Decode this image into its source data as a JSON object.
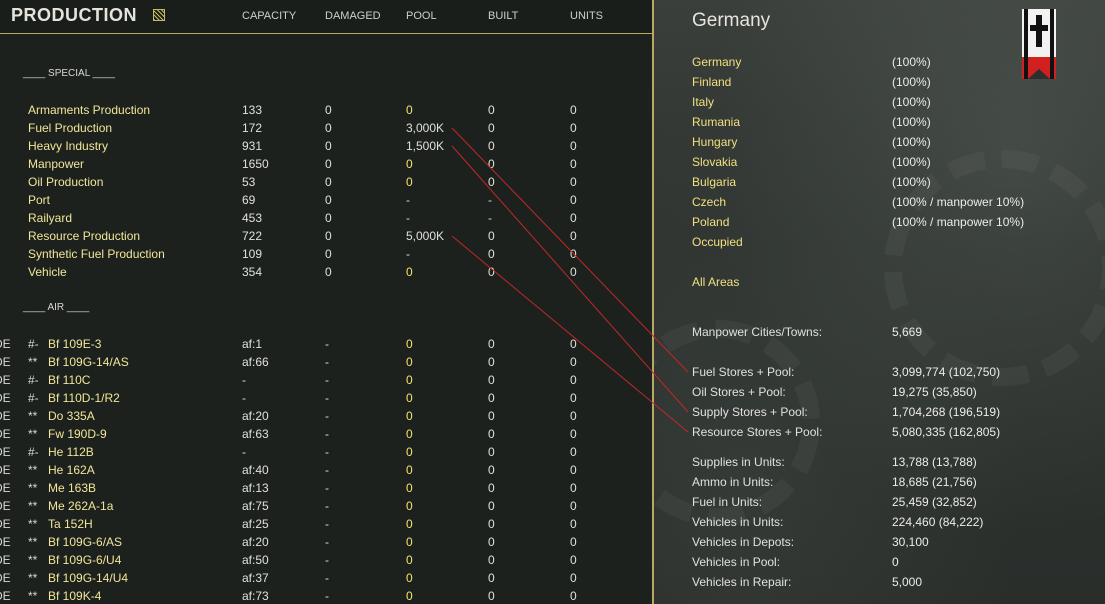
{
  "header": {
    "title": "PRODUCTION",
    "columns": [
      "CAPACITY",
      "DAMAGED",
      "POOL",
      "BUILT",
      "UNITS"
    ]
  },
  "sections": {
    "special": "____ SPECIAL ____",
    "air": "____ AIR ____"
  },
  "special_rows": [
    {
      "name": "Armaments Production",
      "capacity": "133",
      "damaged": "0",
      "pool": "0",
      "built": "0",
      "units": "0"
    },
    {
      "name": "Fuel Production",
      "capacity": "172",
      "damaged": "0",
      "pool": "3,000K",
      "built": "0",
      "units": "0"
    },
    {
      "name": "Heavy Industry",
      "capacity": "931",
      "damaged": "0",
      "pool": "1,500K",
      "built": "0",
      "units": "0"
    },
    {
      "name": "Manpower",
      "capacity": "1650",
      "damaged": "0",
      "pool": "0",
      "built": "0",
      "units": "0"
    },
    {
      "name": "Oil Production",
      "capacity": "53",
      "damaged": "0",
      "pool": "0",
      "built": "0",
      "units": "0"
    },
    {
      "name": "Port",
      "capacity": "69",
      "damaged": "0",
      "pool": "-",
      "built": "-",
      "units": "0"
    },
    {
      "name": "Railyard",
      "capacity": "453",
      "damaged": "0",
      "pool": "-",
      "built": "-",
      "units": "0"
    },
    {
      "name": "Resource Production",
      "capacity": "722",
      "damaged": "0",
      "pool": "5,000K",
      "built": "0",
      "units": "0"
    },
    {
      "name": "Synthetic Fuel Production",
      "capacity": "109",
      "damaged": "0",
      "pool": "-",
      "built": "0",
      "units": "0"
    },
    {
      "name": "Vehicle",
      "capacity": "354",
      "damaged": "0",
      "pool": "0",
      "built": "0",
      "units": "0"
    }
  ],
  "air_rows": [
    {
      "edge": "DE",
      "mark": "#-",
      "name": "Bf 109E-3",
      "capacity": "af:1",
      "damaged": "-",
      "pool": "0",
      "built": "0",
      "units": "0"
    },
    {
      "edge": "DE",
      "mark": "**",
      "name": "Bf 109G-14/AS",
      "capacity": "af:66",
      "damaged": "-",
      "pool": "0",
      "built": "0",
      "units": "0"
    },
    {
      "edge": "DE",
      "mark": "#-",
      "name": "Bf 110C",
      "capacity": "-",
      "damaged": "-",
      "pool": "0",
      "built": "0",
      "units": "0"
    },
    {
      "edge": "DE",
      "mark": "#-",
      "name": "Bf 110D-1/R2",
      "capacity": "-",
      "damaged": "-",
      "pool": "0",
      "built": "0",
      "units": "0"
    },
    {
      "edge": "DE",
      "mark": "**",
      "name": "Do 335A",
      "capacity": "af:20",
      "damaged": "-",
      "pool": "0",
      "built": "0",
      "units": "0"
    },
    {
      "edge": "DE",
      "mark": "**",
      "name": "Fw 190D-9",
      "capacity": "af:63",
      "damaged": "-",
      "pool": "0",
      "built": "0",
      "units": "0"
    },
    {
      "edge": "DE",
      "mark": "#-",
      "name": "He 112B",
      "capacity": "-",
      "damaged": "-",
      "pool": "0",
      "built": "0",
      "units": "0"
    },
    {
      "edge": "DE",
      "mark": "**",
      "name": "He 162A",
      "capacity": "af:40",
      "damaged": "-",
      "pool": "0",
      "built": "0",
      "units": "0"
    },
    {
      "edge": "DE",
      "mark": "**",
      "name": "Me 163B",
      "capacity": "af:13",
      "damaged": "-",
      "pool": "0",
      "built": "0",
      "units": "0"
    },
    {
      "edge": "DE",
      "mark": "**",
      "name": "Me 262A-1a",
      "capacity": "af:75",
      "damaged": "-",
      "pool": "0",
      "built": "0",
      "units": "0"
    },
    {
      "edge": "DE",
      "mark": "**",
      "name": "Ta 152H",
      "capacity": "af:25",
      "damaged": "-",
      "pool": "0",
      "built": "0",
      "units": "0"
    },
    {
      "edge": "DE",
      "mark": "**",
      "name": "Bf 109G-6/AS",
      "capacity": "af:20",
      "damaged": "-",
      "pool": "0",
      "built": "0",
      "units": "0"
    },
    {
      "edge": "DE",
      "mark": "**",
      "name": "Bf 109G-6/U4",
      "capacity": "af:50",
      "damaged": "-",
      "pool": "0",
      "built": "0",
      "units": "0"
    },
    {
      "edge": "DE",
      "mark": "**",
      "name": "Bf 109G-14/U4",
      "capacity": "af:37",
      "damaged": "-",
      "pool": "0",
      "built": "0",
      "units": "0"
    },
    {
      "edge": "DE",
      "mark": "**",
      "name": "Bf 109K-4",
      "capacity": "af:73",
      "damaged": "-",
      "pool": "0",
      "built": "0",
      "units": "0"
    }
  ],
  "right": {
    "title": "Germany",
    "countries": [
      {
        "name": "Germany",
        "value": "(100%)"
      },
      {
        "name": "Finland",
        "value": "(100%)"
      },
      {
        "name": "Italy",
        "value": "(100%)"
      },
      {
        "name": "Rumania",
        "value": "(100%)"
      },
      {
        "name": "Hungary",
        "value": "(100%)"
      },
      {
        "name": "Slovakia",
        "value": "(100%)"
      },
      {
        "name": "Bulgaria",
        "value": "(100%)"
      },
      {
        "name": "Czech",
        "value": "(100% / manpower 10%)"
      },
      {
        "name": "Poland",
        "value": "(100% / manpower 10%)"
      },
      {
        "name": "Occupied",
        "value": ""
      }
    ],
    "all_areas": "All Areas",
    "manpower": {
      "label": "Manpower Cities/Towns:",
      "value": "5,669"
    },
    "stores": [
      {
        "label": "Fuel Stores + Pool:",
        "value": "3,099,774 (102,750)"
      },
      {
        "label": "Oil Stores + Pool:",
        "value": "19,275 (35,850)"
      },
      {
        "label": "Supply Stores + Pool:",
        "value": "1,704,268 (196,519)"
      },
      {
        "label": "Resource Stores + Pool:",
        "value": "5,080,335 (162,805)"
      }
    ],
    "units": [
      {
        "label": "Supplies in Units:",
        "value": "13,788 (13,788)"
      },
      {
        "label": "Ammo in Units:",
        "value": "18,685 (21,756)"
      },
      {
        "label": "Fuel in Units:",
        "value": "25,459 (32,852)"
      },
      {
        "label": "Vehicles in Units:",
        "value": "224,460 (84,222)"
      },
      {
        "label": "Vehicles in Depots:",
        "value": "30,100"
      },
      {
        "label": "Vehicles in Pool:",
        "value": "0"
      },
      {
        "label": "Vehicles in Repair:",
        "value": "5,000"
      }
    ]
  },
  "colors": {
    "accent": "#b8a862",
    "name_yellow": "#f0e69a",
    "pool_yellow": "#f4e66a",
    "annotation_line": "#c0282a"
  },
  "icons": {
    "map": "map-icon",
    "flag": "iron-cross-flag-icon"
  }
}
